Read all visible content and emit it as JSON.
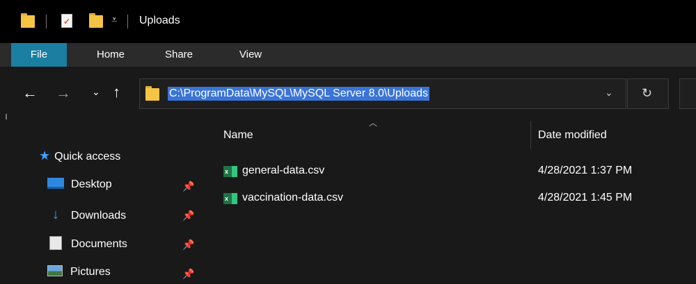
{
  "window": {
    "title": "Uploads",
    "qat_dropdown_glyph": "↕"
  },
  "ribbon": {
    "tabs": [
      "File",
      "Home",
      "Share",
      "View"
    ]
  },
  "address": {
    "path": "C:\\ProgramData\\MySQL\\MySQL Server 8.0\\Uploads"
  },
  "nav": {
    "items": [
      {
        "label": "Quick access",
        "icon": "star-icon",
        "pinned": false
      },
      {
        "label": "Desktop",
        "icon": "desktop-icon",
        "pinned": true
      },
      {
        "label": "Downloads",
        "icon": "download-icon",
        "pinned": true
      },
      {
        "label": "Documents",
        "icon": "documents-icon",
        "pinned": true
      },
      {
        "label": "Pictures",
        "icon": "pictures-icon",
        "pinned": true
      }
    ]
  },
  "columns": {
    "name": "Name",
    "date_modified": "Date modified"
  },
  "files": [
    {
      "name": "general-data.csv",
      "date": "4/28/2021 1:37 PM",
      "icon": "excel-csv-icon"
    },
    {
      "name": "vaccination-data.csv",
      "date": "4/28/2021 1:45 PM",
      "icon": "excel-csv-icon"
    }
  ],
  "colors": {
    "accent_file_tab": "#1a7fa0",
    "selection": "#3a74d7",
    "folder": "#f5c444",
    "quick_access_star": "#3ca0ff"
  }
}
